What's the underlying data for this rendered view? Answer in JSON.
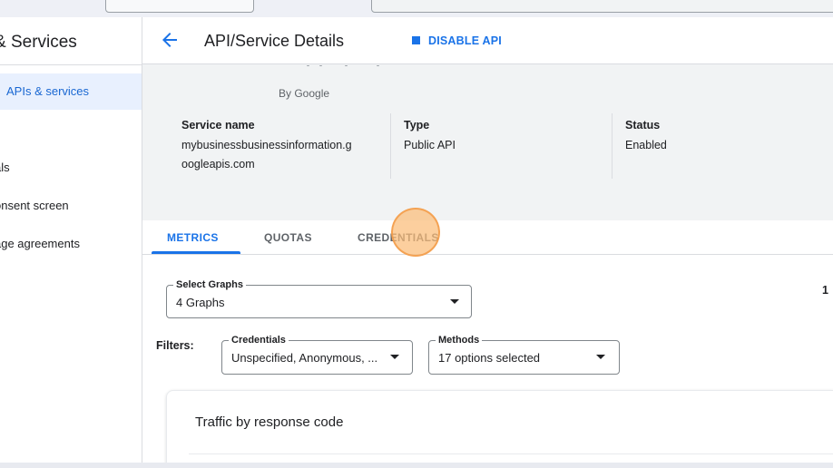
{
  "sidebar": {
    "title": "& Services",
    "items": [
      {
        "label": "APIs & services",
        "active": true
      },
      {
        "label": "als"
      },
      {
        "label": "onsent screen"
      },
      {
        "label": "age agreements"
      }
    ]
  },
  "header": {
    "back_icon": "arrow-back-icon",
    "title": "API/Service Details",
    "disable_label": "DISABLE API",
    "disable_icon": "square-icon"
  },
  "info": {
    "by_line": "By Google",
    "columns": [
      {
        "heading": "Service name",
        "value": "mybusinessbusinessinformation.googleapis.com",
        "value_line1": "mybusinessbusinessinformation.g",
        "value_line2": "oogleapis.com"
      },
      {
        "heading": "Type",
        "value": "Public API"
      },
      {
        "heading": "Status",
        "value": "Enabled"
      }
    ]
  },
  "tabs": [
    {
      "label": "METRICS",
      "active": true
    },
    {
      "label": "QUOTAS"
    },
    {
      "label": "CREDENTIALS"
    }
  ],
  "select_graphs": {
    "label": "Select Graphs",
    "value": "4 Graphs"
  },
  "filters": {
    "label": "Filters:",
    "credentials": {
      "label": "Credentials",
      "value": "Unspecified, Anonymous, ..."
    },
    "methods": {
      "label": "Methods",
      "value": "17 options selected"
    }
  },
  "clipped_text": "1",
  "chart_card": {
    "title": "Traffic by response code"
  },
  "colors": {
    "accent": "#1a73e8",
    "active_bg": "#e8f0fe",
    "cursor_highlight": "#f9b77c"
  }
}
